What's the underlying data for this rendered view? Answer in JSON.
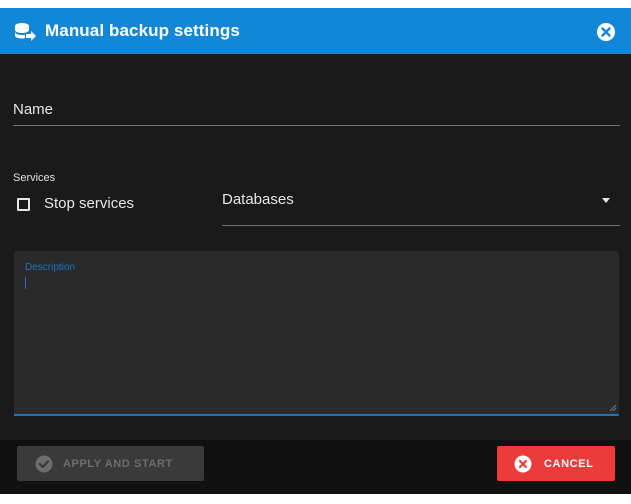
{
  "dialog": {
    "title": "Manual backup settings",
    "title_icon": "database-arrow-icon",
    "close_icon": "close-circle-icon"
  },
  "form": {
    "name": {
      "label": "Name",
      "value": ""
    },
    "services": {
      "section_label": "Services",
      "stop_services_label": "Stop services",
      "stop_services_checked": false
    },
    "databases": {
      "selected": "Databases",
      "icon": "dropdown-arrow-icon"
    },
    "description": {
      "label": "Description",
      "value": ""
    }
  },
  "footer": {
    "apply_label": "APPLY AND START",
    "apply_icon": "check-circle-icon",
    "apply_disabled": true,
    "cancel_label": "CANCEL",
    "cancel_icon": "close-circle-icon"
  },
  "colors": {
    "titlebar": "#1287d8",
    "dialog_bg": "#1a1a1a",
    "accent": "#1a74c4",
    "cancel": "#ed3b3b",
    "disabled_button": "#3a3a3a"
  }
}
